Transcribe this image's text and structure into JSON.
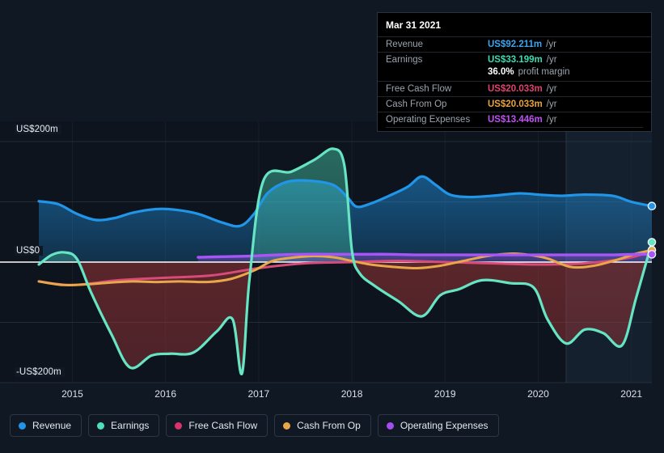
{
  "chart_data": {
    "type": "area",
    "title": "",
    "xlabel": "",
    "ylabel": "",
    "ylim": [
      -200,
      200
    ],
    "xlim": [
      2014.5,
      2021.25
    ],
    "grid": true,
    "legend_position": "bottom",
    "y_ticks": [
      "US$200m",
      "US$0",
      "-US$200m"
    ],
    "y_tick_values": [
      200,
      0,
      -200
    ],
    "x_ticks": [
      "2015",
      "2016",
      "2017",
      "2018",
      "2019",
      "2020",
      "2021"
    ],
    "x_tick_values": [
      2015,
      2016,
      2017,
      2018,
      2019,
      2020,
      2021
    ],
    "units": "US$m",
    "series": [
      {
        "name": "Revenue",
        "color": "#2196e8",
        "x": [
          2014.64,
          2014.85,
          2015.05,
          2015.25,
          2015.45,
          2015.65,
          2015.9,
          2016.1,
          2016.35,
          2016.6,
          2016.8,
          2016.95,
          2017.1,
          2017.3,
          2017.55,
          2017.8,
          2017.95,
          2018.05,
          2018.2,
          2018.4,
          2018.6,
          2018.75,
          2018.9,
          2019.05,
          2019.25,
          2019.5,
          2019.8,
          2020.0,
          2020.25,
          2020.5,
          2020.8,
          2021.0,
          2021.22
        ],
        "values": [
          101,
          96,
          80,
          70,
          73,
          82,
          88,
          87,
          80,
          66,
          60,
          80,
          115,
          133,
          135,
          128,
          108,
          92,
          97,
          110,
          125,
          142,
          128,
          112,
          108,
          110,
          114,
          112,
          110,
          112,
          110,
          100,
          93
        ]
      },
      {
        "name": "Earnings",
        "color": "#66e5c3",
        "x": [
          2014.64,
          2014.78,
          2014.92,
          2015.05,
          2015.2,
          2015.42,
          2015.62,
          2015.85,
          2016.05,
          2016.3,
          2016.55,
          2016.72,
          2016.82,
          2016.9,
          2017.05,
          2017.35,
          2017.6,
          2017.8,
          2017.92,
          2018.0,
          2018.08,
          2018.25,
          2018.5,
          2018.75,
          2018.95,
          2019.15,
          2019.4,
          2019.7,
          2019.95,
          2020.1,
          2020.3,
          2020.5,
          2020.7,
          2020.9,
          2021.05,
          2021.22
        ],
        "values": [
          -4,
          12,
          16,
          5,
          -50,
          -120,
          -175,
          -155,
          -152,
          -150,
          -115,
          -95,
          -185,
          -30,
          135,
          150,
          170,
          188,
          160,
          20,
          -18,
          -40,
          -65,
          -90,
          -55,
          -45,
          -30,
          -35,
          -42,
          -95,
          -135,
          -112,
          -118,
          -138,
          -60,
          33
        ]
      },
      {
        "name": "Free Cash Flow",
        "color": "#d84a7a",
        "x": [
          2014.64,
          2015.0,
          2015.5,
          2016.0,
          2016.5,
          2017.0,
          2017.5,
          2018.0,
          2018.5,
          2019.0,
          2019.5,
          2020.0,
          2020.5,
          2021.0,
          2021.22
        ],
        "values": [
          -32,
          -38,
          -30,
          -26,
          -22,
          -10,
          -2,
          0,
          2,
          0,
          -2,
          -4,
          -2,
          8,
          20
        ]
      },
      {
        "name": "Cash From Op",
        "color": "#e8a84a",
        "x": [
          2014.64,
          2014.9,
          2015.15,
          2015.4,
          2015.65,
          2015.9,
          2016.15,
          2016.45,
          2016.7,
          2016.95,
          2017.15,
          2017.4,
          2017.6,
          2017.8,
          2018.0,
          2018.2,
          2018.45,
          2018.7,
          2018.95,
          2019.2,
          2019.45,
          2019.7,
          2019.9,
          2020.1,
          2020.35,
          2020.6,
          2020.85,
          2021.05,
          2021.22
        ],
        "values": [
          -32,
          -38,
          -37,
          -34,
          -32,
          -33,
          -32,
          -33,
          -28,
          -14,
          2,
          8,
          10,
          8,
          2,
          -4,
          -8,
          -10,
          -6,
          2,
          10,
          14,
          12,
          6,
          -8,
          -6,
          4,
          14,
          20
        ]
      },
      {
        "name": "Operating Expenses",
        "color": "#a855f7",
        "x": [
          2016.35,
          2016.6,
          2016.9,
          2017.2,
          2017.5,
          2017.8,
          2018.1,
          2018.4,
          2018.7,
          2019.0,
          2019.3,
          2019.6,
          2019.9,
          2020.2,
          2020.5,
          2020.8,
          2021.05,
          2021.22
        ],
        "values": [
          8,
          9,
          10,
          12,
          13,
          13,
          13,
          13,
          12,
          12,
          12,
          12,
          12,
          12,
          12,
          12,
          13,
          13
        ]
      }
    ],
    "end_markers": [
      {
        "series": "Revenue",
        "value": 93,
        "color": "#2196e8"
      },
      {
        "series": "Earnings",
        "value": 33,
        "color": "#66e5c3"
      },
      {
        "series": "Cash From Op",
        "value": 20,
        "color": "#e8a84a"
      },
      {
        "series": "Operating Expenses",
        "value": 13,
        "color": "#a855f7"
      }
    ]
  },
  "axis": {
    "y_top": "US$200m",
    "y_zero": "US$0",
    "y_bottom": "-US$200m",
    "x_labels": [
      "2015",
      "2016",
      "2017",
      "2018",
      "2019",
      "2020",
      "2021"
    ]
  },
  "tooltip": {
    "date": "Mar 31 2021",
    "rows": [
      {
        "label": "Revenue",
        "value": "US$92.211m",
        "unit": "/yr",
        "color": "#3da5f0"
      },
      {
        "label": "Earnings",
        "value": "US$33.199m",
        "unit": "/yr",
        "color": "#3ddbb0"
      },
      {
        "label": "Free Cash Flow",
        "value": "US$20.033m",
        "unit": "/yr",
        "color": "#e0416f"
      },
      {
        "label": "Cash From Op",
        "value": "US$20.033m",
        "unit": "/yr",
        "color": "#e8a33c"
      },
      {
        "label": "Operating Expenses",
        "value": "US$13.446m",
        "unit": "/yr",
        "color": "#c050f5"
      }
    ],
    "profit_margin_value": "36.0%",
    "profit_margin_text": "profit margin"
  },
  "legend": {
    "items": [
      {
        "label": "Revenue",
        "color": "#2196e8"
      },
      {
        "label": "Earnings",
        "color": "#4fe0bb"
      },
      {
        "label": "Free Cash Flow",
        "color": "#d8336b"
      },
      {
        "label": "Cash From Op",
        "color": "#e8a84a"
      },
      {
        "label": "Operating Expenses",
        "color": "#a44ef0"
      }
    ]
  },
  "colors": {
    "background": "#101823",
    "zero_line": "#ffffff",
    "grid": "#2a3442"
  }
}
